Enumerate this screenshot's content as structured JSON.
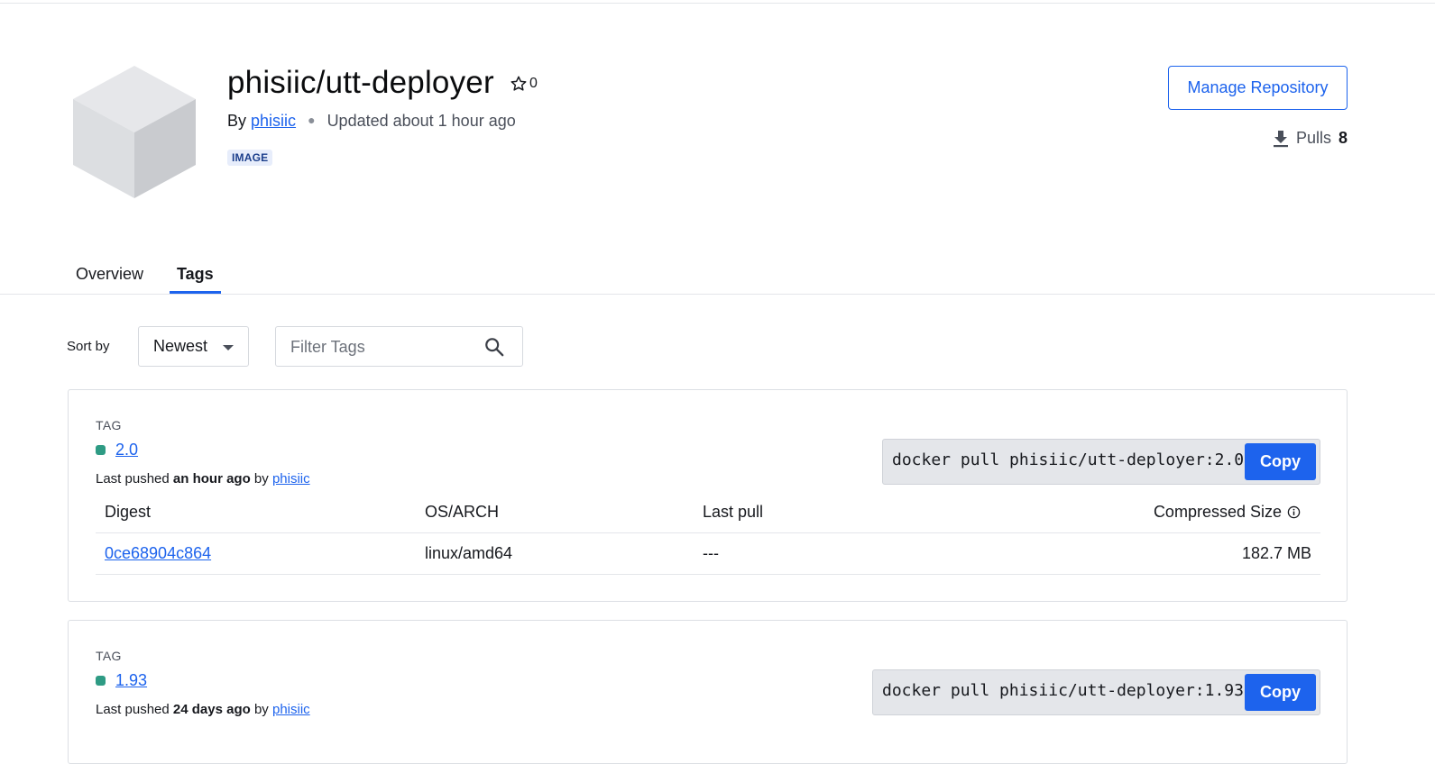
{
  "repo": {
    "name": "phisiic/utt-deployer",
    "stars": "0",
    "by_prefix": "By",
    "owner": "phisiic",
    "updated": "Updated about 1 hour ago",
    "badge": "IMAGE"
  },
  "header": {
    "manage_label": "Manage Repository",
    "pulls_label": "Pulls",
    "pulls_count": "8"
  },
  "tabs": [
    {
      "label": "Overview",
      "active": false
    },
    {
      "label": "Tags",
      "active": true
    }
  ],
  "toolbar": {
    "sort_label": "Sort by",
    "sort_value": "Newest",
    "filter_placeholder": "Filter Tags"
  },
  "tags": [
    {
      "caption": "TAG",
      "name": "2.0",
      "pushed_prefix": "Last pushed",
      "pushed_when": "an hour ago",
      "pushed_by_prefix": "by",
      "pushed_by": "phisiic",
      "pull_command": "docker pull phisiic/utt-deployer:2.0",
      "copy_label": "Copy",
      "columns": [
        "Digest",
        "OS/ARCH",
        "Last pull",
        "Compressed Size"
      ],
      "rows": [
        {
          "digest": "0ce68904c864",
          "os_arch": "linux/amd64",
          "last_pull": "---",
          "size": "182.7 MB"
        }
      ]
    },
    {
      "caption": "TAG",
      "name": "1.93",
      "pushed_prefix": "Last pushed",
      "pushed_when": "24 days ago",
      "pushed_by_prefix": "by",
      "pushed_by": "phisiic",
      "pull_command": "docker pull phisiic/utt-deployer:1.93",
      "copy_label": "Copy"
    }
  ],
  "colors": {
    "accent": "#1d63ed",
    "tag_dot": "#2e9b84",
    "border": "#dcdfe4"
  }
}
